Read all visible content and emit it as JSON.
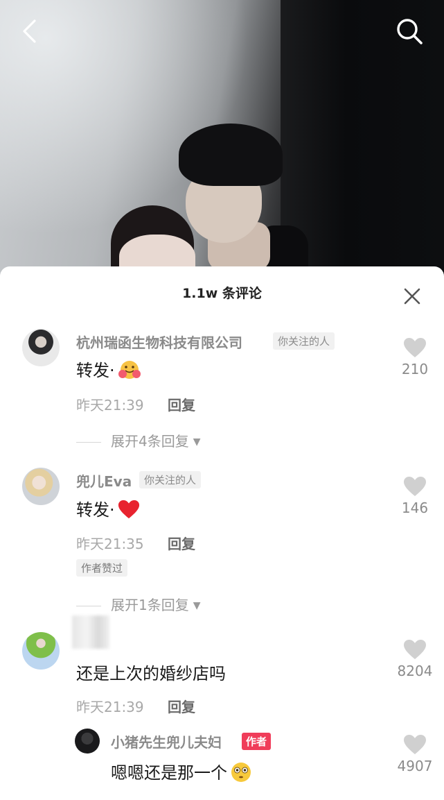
{
  "sheet": {
    "title": "1.1w 条评论"
  },
  "comments": [
    {
      "username": "杭州瑞函生物科技有限公司",
      "tag": "你关注的人",
      "text": "转发·",
      "time": "昨天21:39",
      "reply_label": "回复",
      "likes": "210",
      "expand_label": "展开4条回复",
      "emoji": "hugging-face-icon"
    },
    {
      "username": "兜儿Eva",
      "tag": "你关注的人",
      "text": "转发·",
      "time": "昨天21:35",
      "reply_label": "回复",
      "liked_by_author": "作者赞过",
      "likes": "146",
      "expand_label": "展开1条回复",
      "emoji": "red-heart-icon"
    },
    {
      "username": "",
      "text": "还是上次的婚纱店吗",
      "time": "昨天21:39",
      "reply_label": "回复",
      "likes": "8204"
    }
  ],
  "reply": {
    "username": "小猪先生兜儿夫妇",
    "author_tag": "作者",
    "text": "嗯嗯还是那一个",
    "likes": "4907",
    "emoji": "flushed-face-icon"
  },
  "colors": {
    "author_tag": "#f03d5a",
    "secondary_text": "#8a8a8a",
    "heart": "#d0d0d0"
  }
}
